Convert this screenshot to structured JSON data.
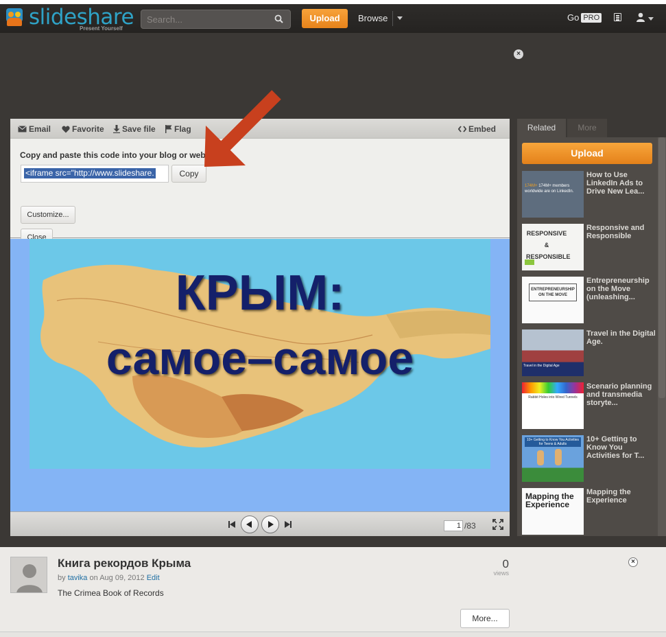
{
  "brand": {
    "name": "slideshare",
    "tagline": "Present Yourself"
  },
  "header": {
    "search_placeholder": "Search...",
    "upload_label": "Upload",
    "browse_label": "Browse",
    "go_label": "Go",
    "pro_label": "PRO"
  },
  "ad": {
    "close_label": "×"
  },
  "toolbar": {
    "email": "Email",
    "favorite": "Favorite",
    "save_file": "Save file",
    "flag": "Flag",
    "embed": "Embed"
  },
  "embed_panel": {
    "title": "Copy and paste this code into your blog or webs",
    "code": "<iframe src=\"http://www.slideshare.",
    "copy_label": "Copy",
    "customize_label": "Customize...",
    "close_label": "Close"
  },
  "slide": {
    "line1": "КРЫМ:",
    "line2": "самое–самое"
  },
  "controls": {
    "current_page": "1",
    "total_pages": "/83"
  },
  "sidebar": {
    "tabs": [
      "Related",
      "More"
    ],
    "upload_label": "Upload",
    "items": [
      {
        "title": "How to Use LinkedIn Ads to Drive New Lea...",
        "thumb_text": "174M+ members worldwide are on LinkedIn."
      },
      {
        "title": "Responsive and Responsible",
        "thumb_text": "RESPONSIVE & RESPONSIBLE"
      },
      {
        "title": "Entrepreneurship on the Move (unleashing...",
        "thumb_text": "ENTREPRENEURSHIP ON THE MOVE"
      },
      {
        "title": "Travel in the Digital Age.",
        "thumb_text": "Travel in the Digital Age"
      },
      {
        "title": "Scenario planning and transmedia storyte...",
        "thumb_text": "Rabbit Holes into Wired Tunnels"
      },
      {
        "title": "10+ Getting to Know You Activities for T...",
        "thumb_text": "10+ Getting to Know You Activities for Teens & Adults"
      },
      {
        "title": "Mapping the Experience",
        "thumb_text": "Mapping the Experience"
      }
    ]
  },
  "details": {
    "title": "Книга рекордов Крыма",
    "by_prefix": "by",
    "author": "tavika",
    "on_label": "on",
    "date": "Aug 09, 2012",
    "edit_label": "Edit",
    "description": "The Crimea Book of Records",
    "views_count": "0",
    "views_label": "views",
    "more_label": "More...",
    "close_label": "×"
  },
  "colors": {
    "accent_orange": "#e8841c",
    "brand_blue": "#2fa3c7",
    "annotation_arrow": "#c8401e"
  }
}
